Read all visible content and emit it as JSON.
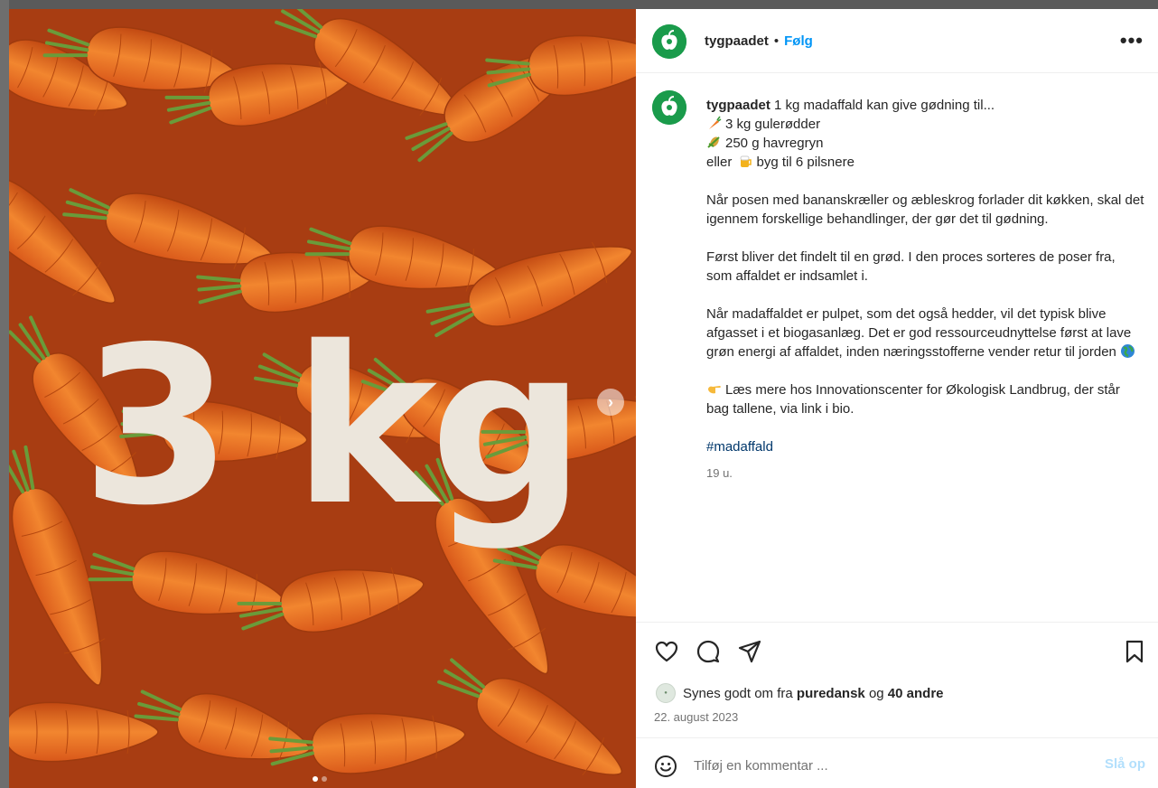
{
  "post": {
    "username": "tygpaadet",
    "separator": "•",
    "follow_label": "Følg",
    "more_label": "•••",
    "image_text": "3 kg",
    "next_label": "›",
    "caption": {
      "author": "tygpaadet",
      "intro": "1 kg madaffald kan give gødning til...",
      "item1": "3 kg gulerødder",
      "item2": "250 g havregryn",
      "item3_pre": "eller",
      "item3_post": "byg til 6 pilsnere",
      "para1": "Når posen med bananskræller og æbleskrog forlader dit køkken, skal det igennem forskellige behandlinger, der gør det til gødning.",
      "para2": "Først bliver det findelt til en grød. I den proces sorteres de poser fra, som affaldet er indsamlet i.",
      "para3": "Når madaffaldet er pulpet, som det også hedder, vil det typisk blive afgasset i et biogasanlæg. Det er god ressourceudnyttelse først at lave grøn energi af affaldet, inden næringsstofferne vender retur til jorden",
      "para4": "Læs mere hos Innovationscenter for Økologisk Landbrug, der står bag tallene, via link i bio.",
      "hashtag": "#madaffald",
      "age": "19 u."
    },
    "icons": {
      "like": "heart-icon",
      "comment": "comment-icon",
      "share": "send-icon",
      "save": "bookmark-icon",
      "emoji": "smiley-icon"
    },
    "likes": {
      "prefix": "Synes godt om fra",
      "user": "puredansk",
      "joiner": "og",
      "others": "40 andre"
    },
    "date": "22. august 2023",
    "comment": {
      "placeholder": "Tilføj en kommentar ...",
      "post_label": "Slå op"
    },
    "carousel": {
      "count": 2,
      "active_index": 0
    }
  },
  "colors": {
    "brand_green": "#1a9b4b",
    "link_blue": "#0095f6",
    "hashtag_blue": "#00376b",
    "image_text": "#ece6dc"
  }
}
